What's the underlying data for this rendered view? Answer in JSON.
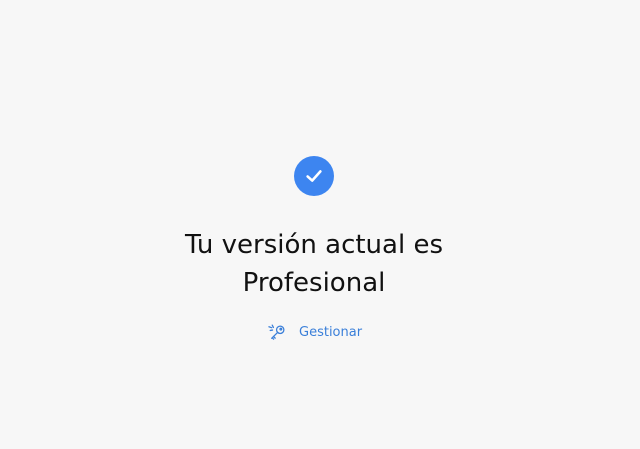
{
  "status": {
    "line1": "Tu versión actual es",
    "line2": "Profesional",
    "icon": "checkmark-circle-icon"
  },
  "manage": {
    "label": "Gestionar",
    "icon": "key-icon"
  },
  "colors": {
    "accent": "#3d85f0",
    "link": "#3a7fd9",
    "background": "#f7f7f7",
    "text": "#111111"
  }
}
